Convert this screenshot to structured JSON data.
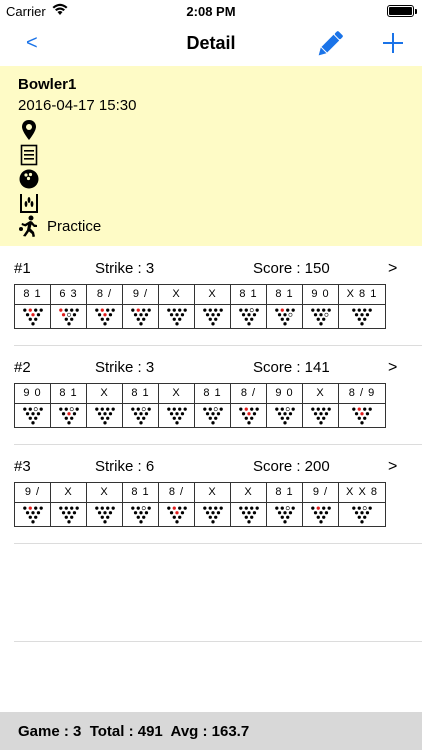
{
  "status_bar": {
    "carrier": "Carrier",
    "time": "2:08 PM"
  },
  "nav": {
    "back_label": "<",
    "title": "Detail",
    "edit_icon": "pencil-icon",
    "add_icon": "plus-icon"
  },
  "accent_color": "#1a73e8",
  "info": {
    "bowler": "Bowler1",
    "datetime": "2016-04-17  15:30",
    "icons": [
      "location-icon",
      "notes-icon",
      "bowling-ball-icon",
      "lane-icon",
      "bowler-icon"
    ],
    "type": "Practice"
  },
  "games": [
    {
      "number": "#1",
      "strike": "Strike : 3",
      "score": "Score : 150",
      "arrow": ">",
      "frames": [
        {
          "marks": "8 1",
          "pins": [
            0,
            0,
            0,
            0,
            0,
            0,
            0,
            0,
            0,
            0
          ],
          "open": []
        },
        {
          "marks": "6 3",
          "pins": [
            0,
            0,
            0,
            0,
            0,
            0,
            0,
            0,
            0,
            0
          ],
          "open": [
            5
          ]
        },
        {
          "marks": "8 /",
          "pins": [
            0,
            0,
            0,
            0,
            0,
            0,
            0,
            0,
            0,
            0
          ],
          "open": []
        },
        {
          "marks": "9 /",
          "pins": [
            0,
            0,
            0,
            0,
            0,
            0,
            0,
            0,
            0,
            0
          ],
          "open": []
        },
        {
          "marks": "X",
          "pins": [
            0,
            0,
            0,
            0,
            0,
            0,
            0,
            0,
            0,
            0
          ],
          "open": []
        },
        {
          "marks": "X",
          "pins": [
            0,
            0,
            0,
            0,
            0,
            0,
            0,
            0,
            0,
            0
          ],
          "open": []
        },
        {
          "marks": "8 1",
          "pins": [
            0,
            0,
            0,
            0,
            0,
            0,
            0,
            0,
            0,
            0
          ],
          "open": [
            9
          ]
        },
        {
          "marks": "8 1",
          "pins": [
            0,
            0,
            0,
            0,
            0,
            0,
            0,
            0,
            0,
            0
          ],
          "open": [
            6
          ]
        },
        {
          "marks": "9 0",
          "pins": [
            0,
            0,
            0,
            0,
            0,
            0,
            0,
            0,
            0,
            0
          ],
          "open": [
            6
          ]
        },
        {
          "marks": "X 8 1",
          "pins": [
            0,
            0,
            0,
            0,
            0,
            0,
            0,
            0,
            0,
            0
          ],
          "open": []
        }
      ],
      "red": [
        [
          8,
          5
        ],
        [
          4,
          5,
          7
        ],
        [
          8,
          5
        ],
        [
          8
        ],
        [],
        [],
        [],
        [
          8,
          6
        ],
        [],
        []
      ]
    },
    {
      "number": "#2",
      "strike": "Strike : 3",
      "score": "Score : 141",
      "arrow": ">",
      "frames": [
        {
          "marks": "9 0",
          "open": [
            9
          ]
        },
        {
          "marks": "8 1",
          "open": [
            9
          ]
        },
        {
          "marks": "X",
          "open": []
        },
        {
          "marks": "8 1",
          "open": [
            9
          ]
        },
        {
          "marks": "X",
          "open": []
        },
        {
          "marks": "8 1",
          "open": [
            9
          ]
        },
        {
          "marks": "8 /",
          "open": []
        },
        {
          "marks": "9 0",
          "open": [
            9
          ]
        },
        {
          "marks": "X",
          "open": []
        },
        {
          "marks": "8 / 9",
          "open": []
        }
      ],
      "red": [
        [],
        [
          5
        ],
        [],
        [],
        [],
        [],
        [
          5,
          8
        ],
        [],
        [],
        [
          5,
          8
        ]
      ]
    },
    {
      "number": "#3",
      "strike": "Strike : 6",
      "score": "Score : 200",
      "arrow": ">",
      "frames": [
        {
          "marks": "9 /",
          "open": []
        },
        {
          "marks": "X",
          "open": []
        },
        {
          "marks": "X",
          "open": []
        },
        {
          "marks": "8 1",
          "open": [
            9
          ]
        },
        {
          "marks": "8 /",
          "open": []
        },
        {
          "marks": "X",
          "open": []
        },
        {
          "marks": "X",
          "open": []
        },
        {
          "marks": "8 1",
          "open": [
            9
          ]
        },
        {
          "marks": "9 /",
          "open": []
        },
        {
          "marks": "X X 8",
          "open": [
            9
          ]
        }
      ],
      "red": [
        [
          8
        ],
        [],
        [],
        [],
        [
          5,
          8
        ],
        [],
        [],
        [],
        [
          8
        ],
        []
      ]
    }
  ],
  "footer": {
    "summary": "Game : 3  Total : 491  Avg : 163.7"
  }
}
